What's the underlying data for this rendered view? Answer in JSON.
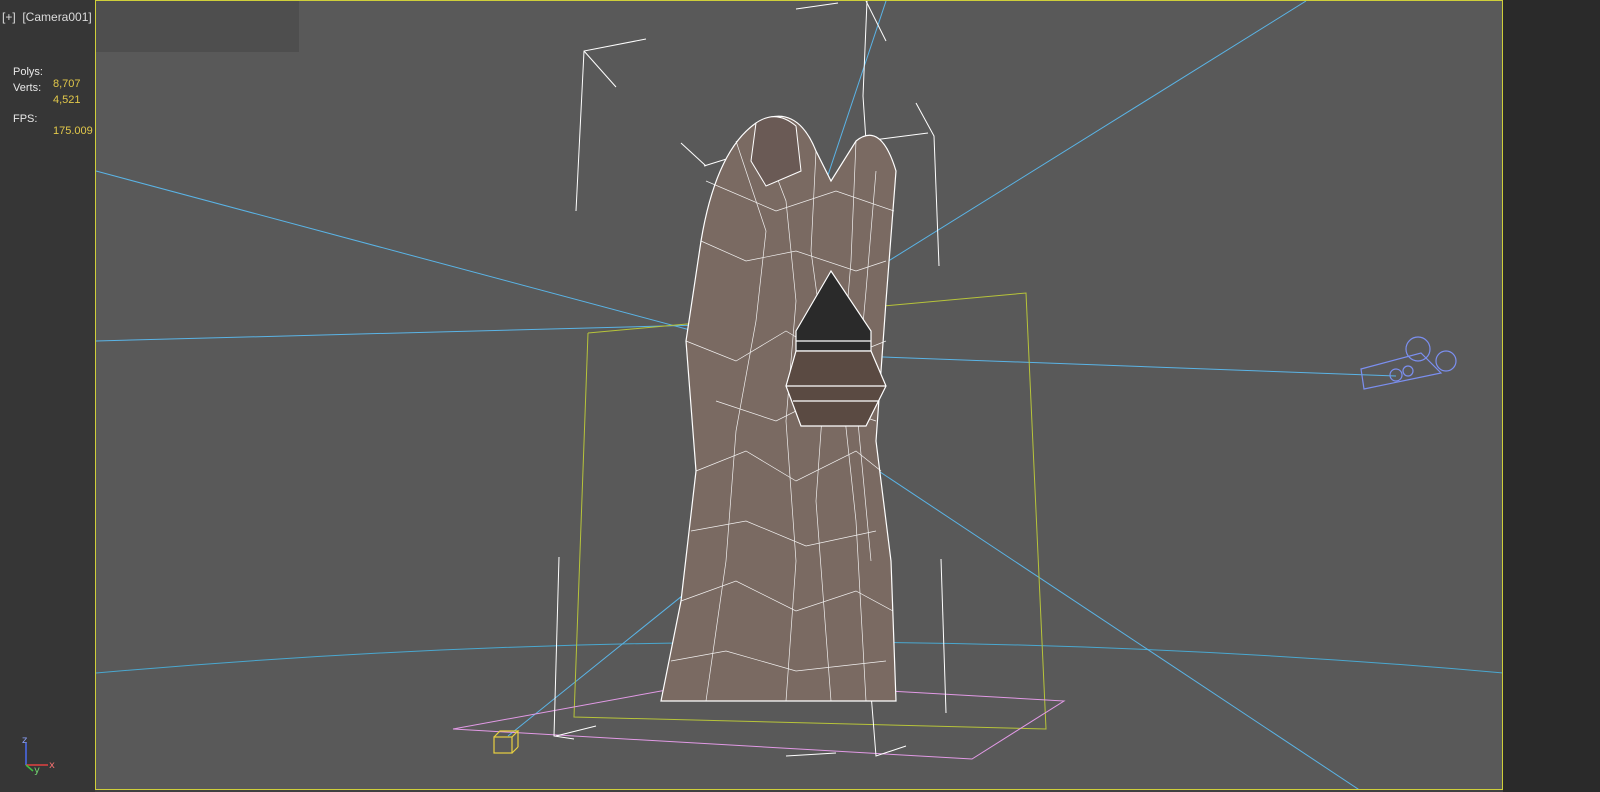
{
  "viewport": {
    "label": "[+]  [Camera001]",
    "label_menu_icon": "plus-menu-icon"
  },
  "stats": {
    "polys_label": "Polys:",
    "polys_value": "8,707",
    "verts_label": "Verts:",
    "verts_value": "4,521",
    "fps_label": "FPS:",
    "fps_value": "175.009"
  },
  "axis_gizmo": {
    "z_label": "z",
    "y_label": "y",
    "x_label": "x"
  },
  "colors": {
    "viewport_bg": "#595959",
    "viewport_border": "#cfcf3a",
    "stat_value": "#e2c84a",
    "camera_lines": "#5ab4e6",
    "bounding_box": "#b7c43a",
    "ground_plane": "#e29ae6",
    "wireframe": "#ffffff",
    "camera_icon": "#7b8ff0"
  },
  "icons": {
    "camera": "camera-icon",
    "light_helper": "light-helper-icon",
    "axis": "axis-tripod-icon"
  }
}
